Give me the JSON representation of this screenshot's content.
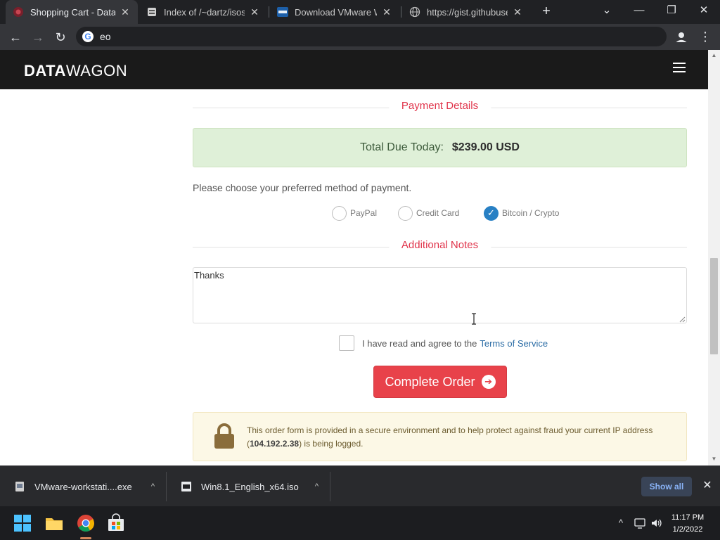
{
  "browser": {
    "tabs": [
      {
        "title": "Shopping Cart - DataW",
        "active": true
      },
      {
        "title": "Index of /~dartz/isos/",
        "active": false
      },
      {
        "title": "Download VMware Wo",
        "active": false
      },
      {
        "title": "https://gist.githubuser",
        "active": false
      }
    ],
    "tab_close_glyph": "✕",
    "new_tab_glyph": "+",
    "window_controls": {
      "dropdown": "⌄",
      "minimize": "—",
      "restore": "❐",
      "close": "✕"
    },
    "nav": {
      "back": "←",
      "forward": "→",
      "reload": "↻"
    },
    "omnibox_text": "eo",
    "menu_glyph": "⋮"
  },
  "site": {
    "logo_bold": "DATA",
    "logo_light": "WAGON"
  },
  "payment": {
    "section_title": "Payment Details",
    "total_label": "Total Due Today:",
    "total_amount": "$239.00 USD",
    "choose_text": "Please choose your preferred method of payment.",
    "options": [
      {
        "label": "PayPal",
        "selected": false
      },
      {
        "label": "Credit Card",
        "selected": false
      },
      {
        "label": "Bitcoin / Crypto",
        "selected": true
      }
    ],
    "check_glyph": "✓"
  },
  "notes": {
    "section_title": "Additional Notes",
    "value": "Thanks"
  },
  "tos": {
    "label": "I have read and agree to the",
    "link": "Terms of Service"
  },
  "complete_button": {
    "label": "Complete Order",
    "arrow_glyph": "➔"
  },
  "secure_notice": {
    "text_before": "This order form is provided in a secure environment and to help protect against fraud your current IP address (",
    "ip": "104.192.2.38",
    "text_after": ") is being logged."
  },
  "downloads": {
    "items": [
      {
        "name": "VMware-workstati....exe"
      },
      {
        "name": "Win8.1_English_x64.iso"
      }
    ],
    "chevron_glyph": "^",
    "show_all": "Show all",
    "close_glyph": "✕"
  },
  "taskbar": {
    "time": "11:17 PM",
    "date": "1/2/2022",
    "tray_chevron": "^"
  },
  "colors": {
    "accent_red": "#e8424a",
    "section_red": "#e0334a",
    "success_bg": "#dff0d8",
    "radio_blue": "#2880c4",
    "notice_bg": "#fcf8e6"
  }
}
